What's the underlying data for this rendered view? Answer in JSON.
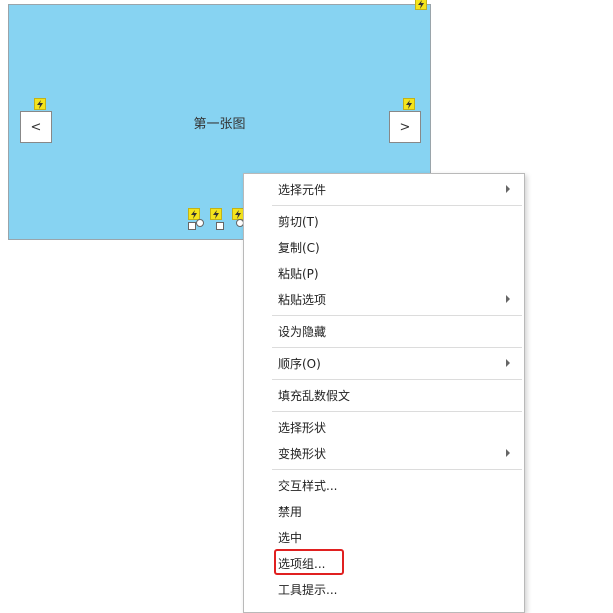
{
  "carousel": {
    "title": "第一张图",
    "prev_label": "<",
    "next_label": ">"
  },
  "context_menu": {
    "items": [
      {
        "label": "选择元件",
        "submenu": true
      },
      {
        "label": "剪切(T)"
      },
      {
        "label": "复制(C)"
      },
      {
        "label": "粘贴(P)"
      },
      {
        "label": "粘贴选项",
        "submenu": true
      },
      {
        "label": "设为隐藏"
      },
      {
        "label": "顺序(O)",
        "submenu": true
      },
      {
        "label": "填充乱数假文"
      },
      {
        "label": "选择形状"
      },
      {
        "label": "变换形状",
        "submenu": true
      },
      {
        "label": "交互样式..."
      },
      {
        "label": "禁用"
      },
      {
        "label": "选中"
      },
      {
        "label": "选项组...",
        "highlighted": true
      },
      {
        "label": "工具提示..."
      }
    ]
  },
  "colors": {
    "canvas_fill": "#87d3f2",
    "interaction_marker": "#f4e41c",
    "highlight_box": "#e02020"
  },
  "icons": {
    "interaction_marker": "lightning-bolt-icon",
    "submenu_indicator": "triangle-right-icon"
  }
}
